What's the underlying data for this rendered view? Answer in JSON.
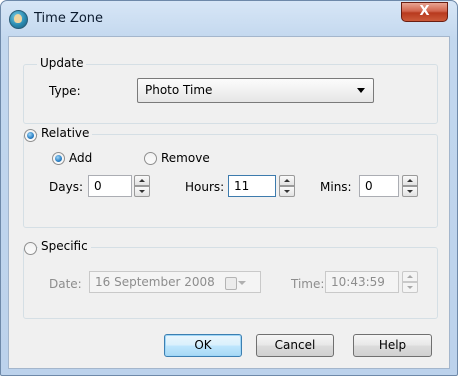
{
  "window": {
    "title": "Time Zone",
    "close_glyph": "X"
  },
  "update_group": {
    "label": "Update",
    "type_label": "Type:",
    "type_value": "Photo Time"
  },
  "relative_group": {
    "label": "Relative",
    "selected": true,
    "add_label": "Add",
    "add_selected": true,
    "remove_label": "Remove",
    "remove_selected": false,
    "days_label": "Days:",
    "days_value": "0",
    "hours_label": "Hours:",
    "hours_value": "11",
    "mins_label": "Mins:",
    "mins_value": "0"
  },
  "specific_group": {
    "label": "Specific",
    "selected": false,
    "date_label": "Date:",
    "date_value": "16 September 2008",
    "time_label": "Time:",
    "time_value": "10:43:59"
  },
  "buttons": {
    "ok": "OK",
    "cancel": "Cancel",
    "help": "Help"
  },
  "icons": {
    "app": "globe-user-icon",
    "close": "close-icon",
    "calendar": "calendar-icon"
  },
  "colors": {
    "close_button": "#c7462a",
    "window_frame": "#bcd2ec",
    "client_bg": "#f0f0f0",
    "focus_border": "#3d7bad"
  }
}
